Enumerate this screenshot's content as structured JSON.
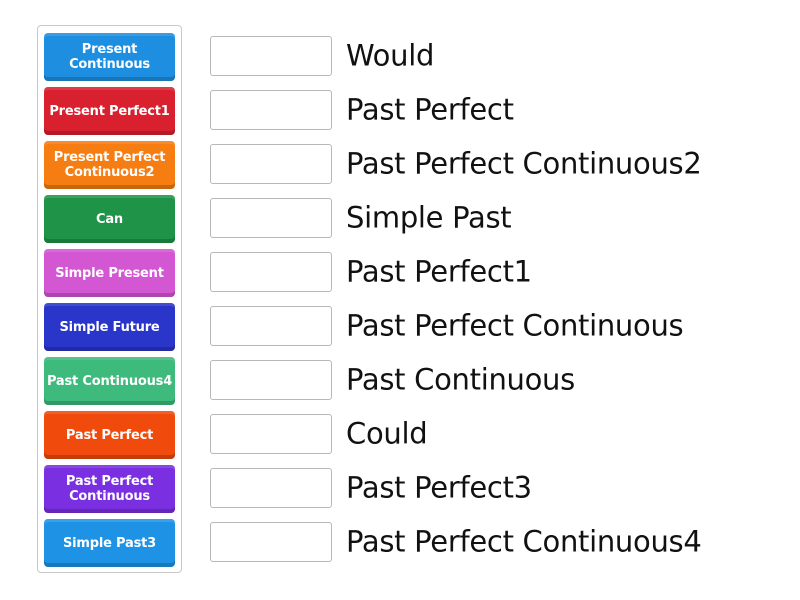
{
  "tiles": [
    {
      "label": "Present Continuous",
      "color": "#1e8fe0"
    },
    {
      "label": "Present Perfect1",
      "color": "#d8202f"
    },
    {
      "label": "Present Perfect Continuous2",
      "color": "#f57d11"
    },
    {
      "label": "Can",
      "color": "#1f9448"
    },
    {
      "label": "Simple Present",
      "color": "#d357d3"
    },
    {
      "label": "Simple Future",
      "color": "#2a35c9"
    },
    {
      "label": "Past Continuous4",
      "color": "#3dba7c"
    },
    {
      "label": "Past Perfect",
      "color": "#f04a0c"
    },
    {
      "label": "Past Perfect Continuous",
      "color": "#7a2fe0"
    },
    {
      "label": "Simple Past3",
      "color": "#1e93e6"
    }
  ],
  "targets": [
    {
      "label": "Would",
      "value": ""
    },
    {
      "label": "Past Perfect",
      "value": ""
    },
    {
      "label": "Past Perfect Continuous2",
      "value": ""
    },
    {
      "label": "Simple Past",
      "value": ""
    },
    {
      "label": "Past Perfect1",
      "value": ""
    },
    {
      "label": "Past Perfect Continuous",
      "value": ""
    },
    {
      "label": "Past Continuous",
      "value": ""
    },
    {
      "label": "Could",
      "value": ""
    },
    {
      "label": "Past Perfect3",
      "value": ""
    },
    {
      "label": "Past Perfect Continuous4",
      "value": ""
    }
  ]
}
